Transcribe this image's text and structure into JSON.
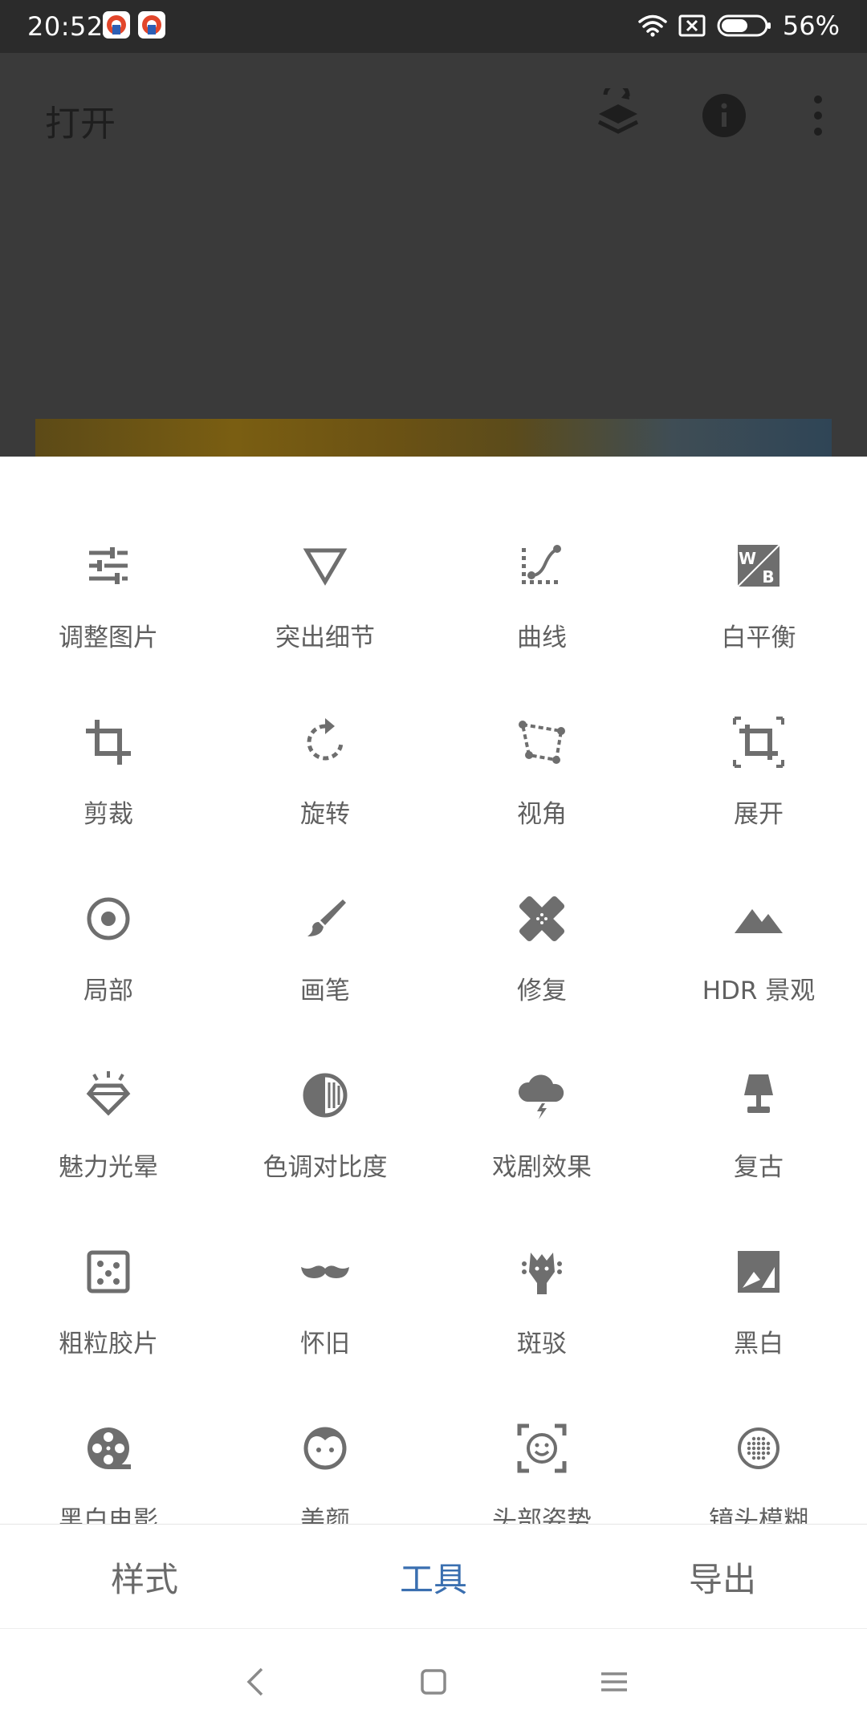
{
  "status_bar": {
    "time": "20:52",
    "battery_percent": "56%",
    "icons": [
      "app-notification-icon",
      "app-notification-icon",
      "wifi-icon",
      "sim-off-icon",
      "battery-icon"
    ]
  },
  "app_bar": {
    "title": "打开",
    "actions": [
      "layers-undo-icon",
      "info-icon",
      "more-vert-icon"
    ]
  },
  "tools": [
    {
      "label": "调整图片",
      "icon": "tune-sliders-icon"
    },
    {
      "label": "突出细节",
      "icon": "details-triangle-icon"
    },
    {
      "label": "曲线",
      "icon": "curves-icon"
    },
    {
      "label": "白平衡",
      "icon": "white-balance-icon"
    },
    {
      "label": "剪裁",
      "icon": "crop-icon"
    },
    {
      "label": "旋转",
      "icon": "rotate-icon"
    },
    {
      "label": "视角",
      "icon": "perspective-icon"
    },
    {
      "label": "展开",
      "icon": "expand-icon"
    },
    {
      "label": "局部",
      "icon": "selective-icon"
    },
    {
      "label": "画笔",
      "icon": "brush-icon"
    },
    {
      "label": "修复",
      "icon": "healing-icon"
    },
    {
      "label": "HDR 景观",
      "icon": "hdr-mountains-icon"
    },
    {
      "label": "魅力光晕",
      "icon": "glamour-glow-icon"
    },
    {
      "label": "色调对比度",
      "icon": "tonal-contrast-icon"
    },
    {
      "label": "戏剧效果",
      "icon": "drama-cloud-icon"
    },
    {
      "label": "复古",
      "icon": "vintage-lamp-icon"
    },
    {
      "label": "粗粒胶片",
      "icon": "grainy-film-icon"
    },
    {
      "label": "怀旧",
      "icon": "retrolux-mustache-icon"
    },
    {
      "label": "斑驳",
      "icon": "grunge-guitar-icon"
    },
    {
      "label": "黑白",
      "icon": "black-white-icon"
    },
    {
      "label": "黑白电影",
      "icon": "noir-film-reel-icon"
    },
    {
      "label": "美颜",
      "icon": "face-enhance-icon"
    },
    {
      "label": "头部姿势",
      "icon": "head-pose-icon"
    },
    {
      "label": "镜头模糊",
      "icon": "lens-blur-icon"
    }
  ],
  "tabs": [
    {
      "label": "样式",
      "active": false
    },
    {
      "label": "工具",
      "active": true
    },
    {
      "label": "导出",
      "active": false
    }
  ],
  "nav": [
    "back-icon",
    "home-icon",
    "menu-icon"
  ],
  "colors": {
    "accent": "#3a6fb0",
    "icon_gray": "#6e6e6e",
    "label_gray": "#606060",
    "status_bg": "#2b2b2b",
    "scrim": "#3a3a3a"
  }
}
